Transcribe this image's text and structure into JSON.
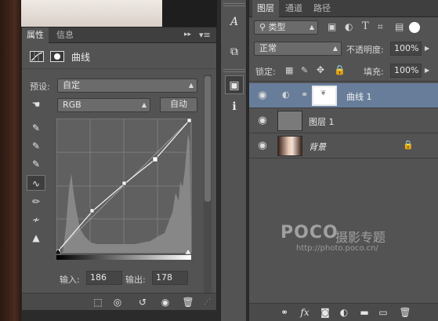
{
  "properties_panel": {
    "tabs": [
      "属性",
      "信息"
    ],
    "adjustment_title": "曲线",
    "preset_label": "预设:",
    "preset_value": "自定",
    "channel_value": "RGB",
    "auto_button": "自动",
    "input_label": "输入:",
    "input_value": "186",
    "output_label": "输出:",
    "output_value": "178"
  },
  "layers_panel": {
    "tabs": [
      "图层",
      "通道",
      "路径"
    ],
    "filter_kind": "类型",
    "blend_mode": "正常",
    "opacity_label": "不透明度:",
    "opacity_value": "100%",
    "lock_label": "锁定:",
    "fill_label": "填充:",
    "fill_value": "100%",
    "layers": [
      {
        "name": "曲线 1"
      },
      {
        "name": "图层 1"
      },
      {
        "name": "背景"
      }
    ]
  },
  "watermark": {
    "brand": "POCO",
    "tagline": "摄影专题",
    "url": "http://photo.poco.cn/"
  }
}
